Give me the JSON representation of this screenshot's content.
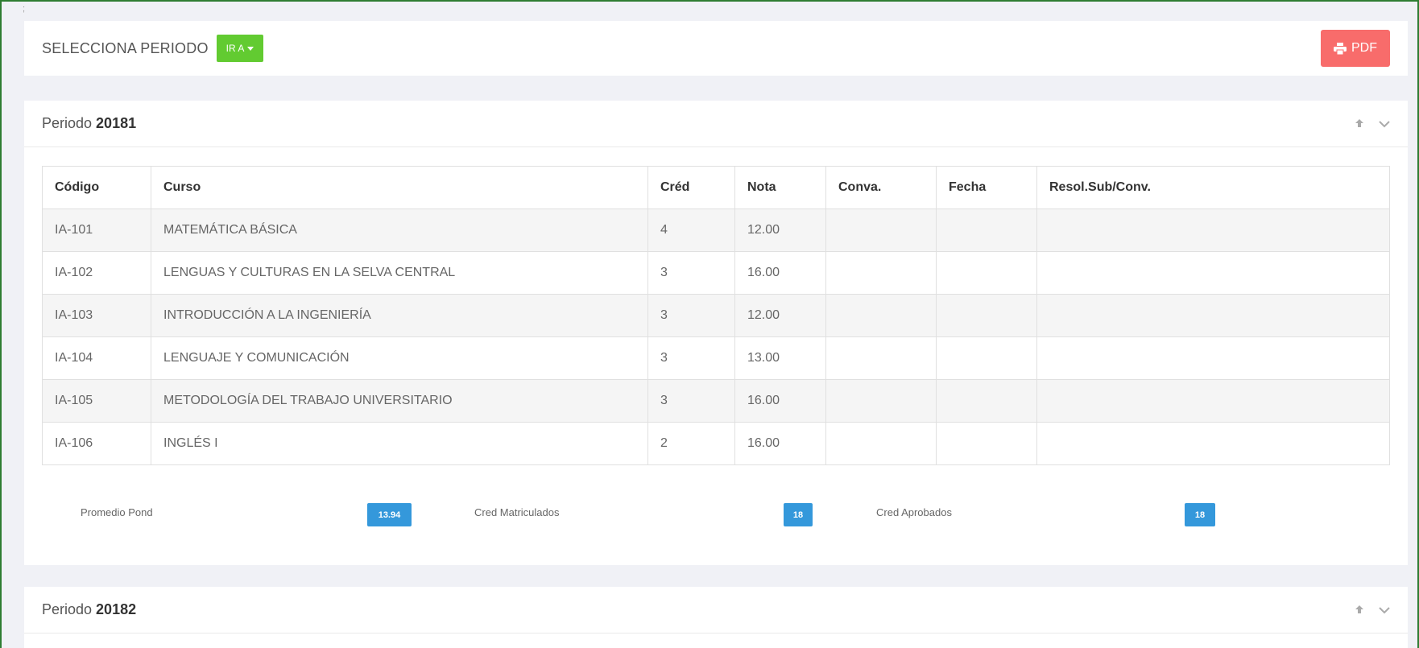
{
  "top_bar": {
    "tick": ";",
    "select_label": "SELECCIONA PERIODO",
    "goto_label": "IR A",
    "pdf_label": "PDF"
  },
  "colors": {
    "goto_button": "#62cb31",
    "pdf_button": "#f86c6b",
    "badge": "#3498db",
    "frame_border": "#2e7d32"
  },
  "periods": [
    {
      "label": "Periodo",
      "number": "20181",
      "columns": [
        "Código",
        "Curso",
        "Créd",
        "Nota",
        "Conva.",
        "Fecha",
        "Resol.Sub/Conv."
      ],
      "rows": [
        [
          "IA-101",
          "MATEMÁTICA BÁSICA",
          "4",
          "12.00",
          "",
          "",
          ""
        ],
        [
          "IA-102",
          "LENGUAS Y CULTURAS EN LA SELVA CENTRAL",
          "3",
          "16.00",
          "",
          "",
          ""
        ],
        [
          "IA-103",
          "INTRODUCCIÓN A LA INGENIERÍA",
          "3",
          "12.00",
          "",
          "",
          ""
        ],
        [
          "IA-104",
          "LENGUAJE Y COMUNICACIÓN",
          "3",
          "13.00",
          "",
          "",
          ""
        ],
        [
          "IA-105",
          "METODOLOGÍA DEL TRABAJO UNIVERSITARIO",
          "3",
          "16.00",
          "",
          "",
          ""
        ],
        [
          "IA-106",
          "INGLÉS I",
          "2",
          "16.00",
          "",
          "",
          ""
        ]
      ],
      "stats": {
        "avg_label": "Promedio Pond",
        "avg_value": "13.94",
        "enrolled_label": "Cred Matriculados",
        "enrolled_value": "18",
        "approved_label": "Cred Aprobados",
        "approved_value": "18"
      }
    },
    {
      "label": "Periodo",
      "number": "20182"
    }
  ],
  "icons": {
    "collapse": "arrow-up-icon",
    "expand": "chevron-down-icon",
    "pdf": "printer-icon",
    "dropdown": "caret-down-icon"
  }
}
